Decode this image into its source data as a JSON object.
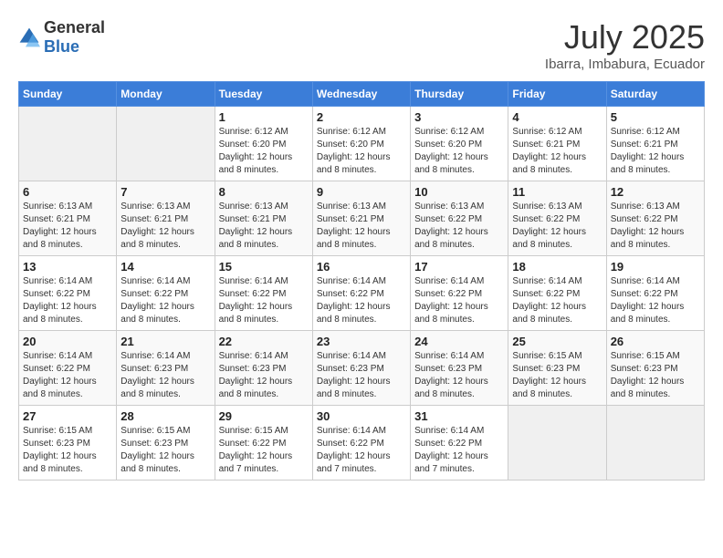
{
  "logo": {
    "general": "General",
    "blue": "Blue"
  },
  "header": {
    "title": "July 2025",
    "subtitle": "Ibarra, Imbabura, Ecuador"
  },
  "days_of_week": [
    "Sunday",
    "Monday",
    "Tuesday",
    "Wednesday",
    "Thursday",
    "Friday",
    "Saturday"
  ],
  "weeks": [
    [
      {
        "day": "",
        "info": ""
      },
      {
        "day": "",
        "info": ""
      },
      {
        "day": "1",
        "info": "Sunrise: 6:12 AM\nSunset: 6:20 PM\nDaylight: 12 hours and 8 minutes."
      },
      {
        "day": "2",
        "info": "Sunrise: 6:12 AM\nSunset: 6:20 PM\nDaylight: 12 hours and 8 minutes."
      },
      {
        "day": "3",
        "info": "Sunrise: 6:12 AM\nSunset: 6:20 PM\nDaylight: 12 hours and 8 minutes."
      },
      {
        "day": "4",
        "info": "Sunrise: 6:12 AM\nSunset: 6:21 PM\nDaylight: 12 hours and 8 minutes."
      },
      {
        "day": "5",
        "info": "Sunrise: 6:12 AM\nSunset: 6:21 PM\nDaylight: 12 hours and 8 minutes."
      }
    ],
    [
      {
        "day": "6",
        "info": "Sunrise: 6:13 AM\nSunset: 6:21 PM\nDaylight: 12 hours and 8 minutes."
      },
      {
        "day": "7",
        "info": "Sunrise: 6:13 AM\nSunset: 6:21 PM\nDaylight: 12 hours and 8 minutes."
      },
      {
        "day": "8",
        "info": "Sunrise: 6:13 AM\nSunset: 6:21 PM\nDaylight: 12 hours and 8 minutes."
      },
      {
        "day": "9",
        "info": "Sunrise: 6:13 AM\nSunset: 6:21 PM\nDaylight: 12 hours and 8 minutes."
      },
      {
        "day": "10",
        "info": "Sunrise: 6:13 AM\nSunset: 6:22 PM\nDaylight: 12 hours and 8 minutes."
      },
      {
        "day": "11",
        "info": "Sunrise: 6:13 AM\nSunset: 6:22 PM\nDaylight: 12 hours and 8 minutes."
      },
      {
        "day": "12",
        "info": "Sunrise: 6:13 AM\nSunset: 6:22 PM\nDaylight: 12 hours and 8 minutes."
      }
    ],
    [
      {
        "day": "13",
        "info": "Sunrise: 6:14 AM\nSunset: 6:22 PM\nDaylight: 12 hours and 8 minutes."
      },
      {
        "day": "14",
        "info": "Sunrise: 6:14 AM\nSunset: 6:22 PM\nDaylight: 12 hours and 8 minutes."
      },
      {
        "day": "15",
        "info": "Sunrise: 6:14 AM\nSunset: 6:22 PM\nDaylight: 12 hours and 8 minutes."
      },
      {
        "day": "16",
        "info": "Sunrise: 6:14 AM\nSunset: 6:22 PM\nDaylight: 12 hours and 8 minutes."
      },
      {
        "day": "17",
        "info": "Sunrise: 6:14 AM\nSunset: 6:22 PM\nDaylight: 12 hours and 8 minutes."
      },
      {
        "day": "18",
        "info": "Sunrise: 6:14 AM\nSunset: 6:22 PM\nDaylight: 12 hours and 8 minutes."
      },
      {
        "day": "19",
        "info": "Sunrise: 6:14 AM\nSunset: 6:22 PM\nDaylight: 12 hours and 8 minutes."
      }
    ],
    [
      {
        "day": "20",
        "info": "Sunrise: 6:14 AM\nSunset: 6:22 PM\nDaylight: 12 hours and 8 minutes."
      },
      {
        "day": "21",
        "info": "Sunrise: 6:14 AM\nSunset: 6:23 PM\nDaylight: 12 hours and 8 minutes."
      },
      {
        "day": "22",
        "info": "Sunrise: 6:14 AM\nSunset: 6:23 PM\nDaylight: 12 hours and 8 minutes."
      },
      {
        "day": "23",
        "info": "Sunrise: 6:14 AM\nSunset: 6:23 PM\nDaylight: 12 hours and 8 minutes."
      },
      {
        "day": "24",
        "info": "Sunrise: 6:14 AM\nSunset: 6:23 PM\nDaylight: 12 hours and 8 minutes."
      },
      {
        "day": "25",
        "info": "Sunrise: 6:15 AM\nSunset: 6:23 PM\nDaylight: 12 hours and 8 minutes."
      },
      {
        "day": "26",
        "info": "Sunrise: 6:15 AM\nSunset: 6:23 PM\nDaylight: 12 hours and 8 minutes."
      }
    ],
    [
      {
        "day": "27",
        "info": "Sunrise: 6:15 AM\nSunset: 6:23 PM\nDaylight: 12 hours and 8 minutes."
      },
      {
        "day": "28",
        "info": "Sunrise: 6:15 AM\nSunset: 6:23 PM\nDaylight: 12 hours and 8 minutes."
      },
      {
        "day": "29",
        "info": "Sunrise: 6:15 AM\nSunset: 6:22 PM\nDaylight: 12 hours and 7 minutes."
      },
      {
        "day": "30",
        "info": "Sunrise: 6:14 AM\nSunset: 6:22 PM\nDaylight: 12 hours and 7 minutes."
      },
      {
        "day": "31",
        "info": "Sunrise: 6:14 AM\nSunset: 6:22 PM\nDaylight: 12 hours and 7 minutes."
      },
      {
        "day": "",
        "info": ""
      },
      {
        "day": "",
        "info": ""
      }
    ]
  ]
}
